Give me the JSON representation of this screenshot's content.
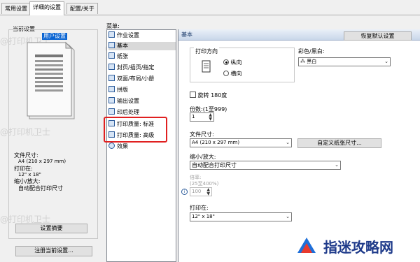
{
  "tabs": [
    "常用设置",
    "详细的设置",
    "配置/关于"
  ],
  "left": {
    "current_settings": "当前设置",
    "highlight": "用户设置",
    "info_paper_size_label": "文件尺寸:",
    "info_paper_size": "A4 (210 x 297 mm)",
    "info_print_on_label": "打印在:",
    "info_print_on": "12\" x 18\"",
    "info_scale_label": "缩小/放大:",
    "info_scale": "自动配合打印尺寸",
    "summary_button": "设置摘要",
    "register_button": "注册当前设置..."
  },
  "menu": {
    "label": "菜单:",
    "items": [
      "作业设置",
      "基本",
      "纸张",
      "封页/插页/指定",
      "双面/布局/小册",
      "拼版",
      "输出设置",
      "印后处理",
      "打印质量: 标准",
      "打印质量: 高级",
      "效果"
    ]
  },
  "basic": {
    "header": "基本",
    "restore_button": "恢复默认设置",
    "orientation_label": "打印方向",
    "portrait": "纵向",
    "landscape": "横向",
    "color_label": "彩色/黑白:",
    "color_value": "黑白",
    "rotate_label": "旋转 180度",
    "copies_label": "份数:(1至999)",
    "copies_value": "1",
    "paper_size_label": "文件尺寸:",
    "paper_size_value": "A4 (210 x 297 mm)",
    "custom_size_button": "自定义纸张尺寸...",
    "scale_label": "缩小/放大:",
    "scale_value": "自动配合打印尺寸",
    "ratio_label": "倍率:",
    "ratio_range": "(25至400%)",
    "ratio_value": "100",
    "print_on_label": "打印在:",
    "print_on_value": "12\" x 18\""
  },
  "watermark": "@打印机卫士",
  "brand": "指迷攻略网",
  "colors": {
    "highlight": "#0a64d2",
    "red_box": "#e02020",
    "brand": "#1e3a8a"
  }
}
